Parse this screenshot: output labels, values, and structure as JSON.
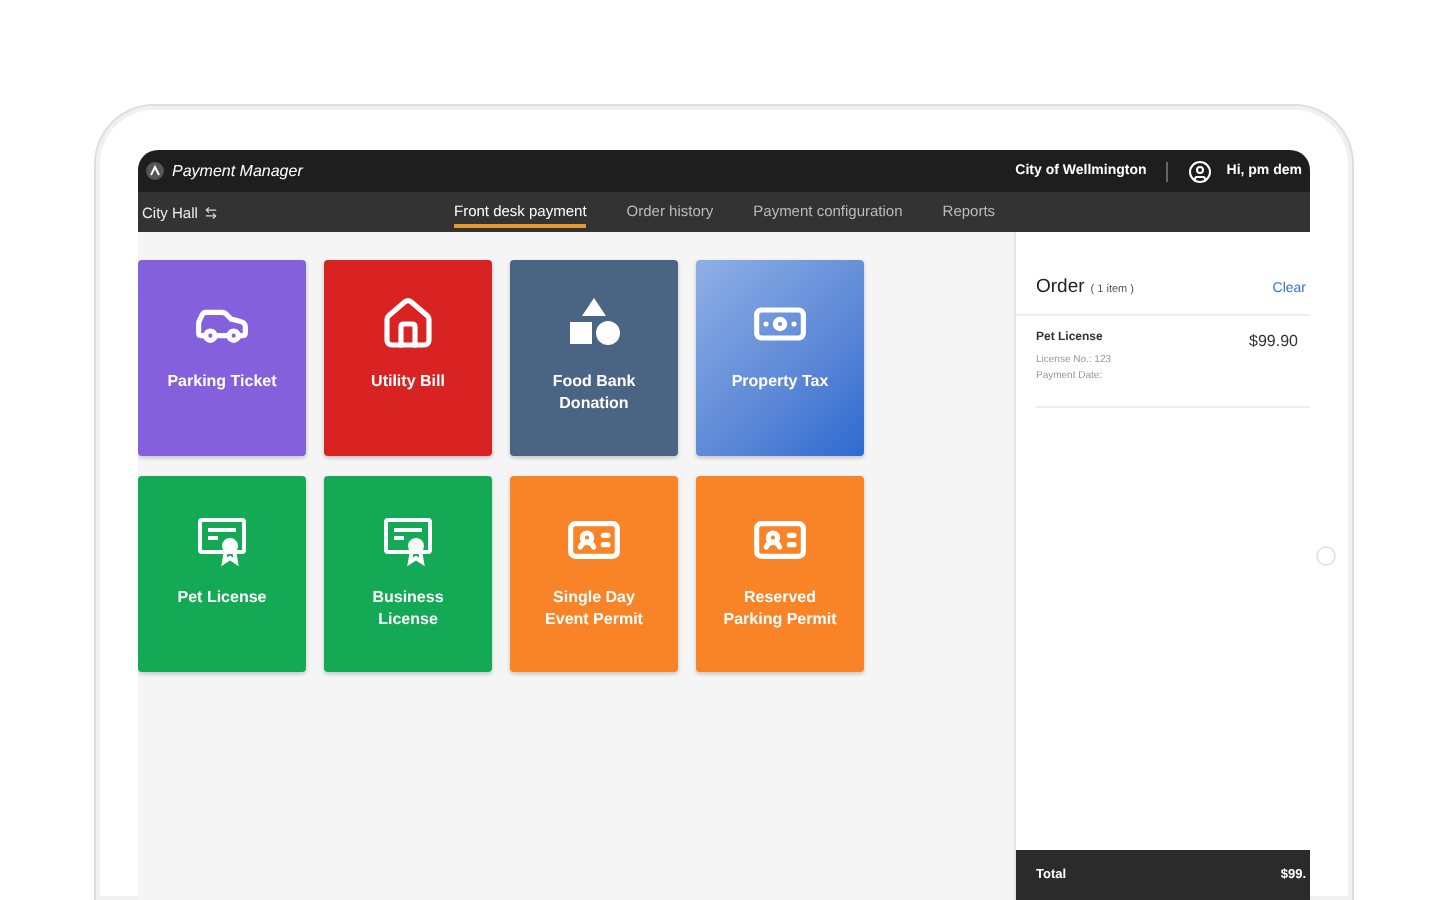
{
  "app": {
    "title": "Payment Manager",
    "city": "City of Wellmington",
    "user": "Hi, pm dem"
  },
  "location": {
    "label": "City Hall"
  },
  "tabs": [
    {
      "label": "Front desk payment",
      "selected": true
    },
    {
      "label": "Order history",
      "selected": false
    },
    {
      "label": "Payment configuration",
      "selected": false
    },
    {
      "label": "Reports",
      "selected": false
    }
  ],
  "tiles": [
    {
      "label": "Parking Ticket",
      "color": "#8460dc"
    },
    {
      "label": "Utility Bill",
      "color": "#d92323"
    },
    {
      "label": "Food Bank Donation",
      "color": "#4a6584"
    },
    {
      "label": "Property Tax",
      "color": "#5b87d6"
    },
    {
      "label": "Pet License",
      "color": "#13a955"
    },
    {
      "label": "Business License",
      "color": "#13a955"
    },
    {
      "label": "Single Day Event Permit",
      "color": "#f98427"
    },
    {
      "label": "Reserved Parking Permit",
      "color": "#f98427"
    }
  ],
  "order": {
    "title": "Order",
    "count": "( 1 item )",
    "clear": "Clear",
    "items": [
      {
        "name": "Pet License",
        "price": "$99.90",
        "details": [
          "License No.: 123",
          "Payment Date:"
        ]
      }
    ],
    "total_label": "Total",
    "total": "$99."
  }
}
